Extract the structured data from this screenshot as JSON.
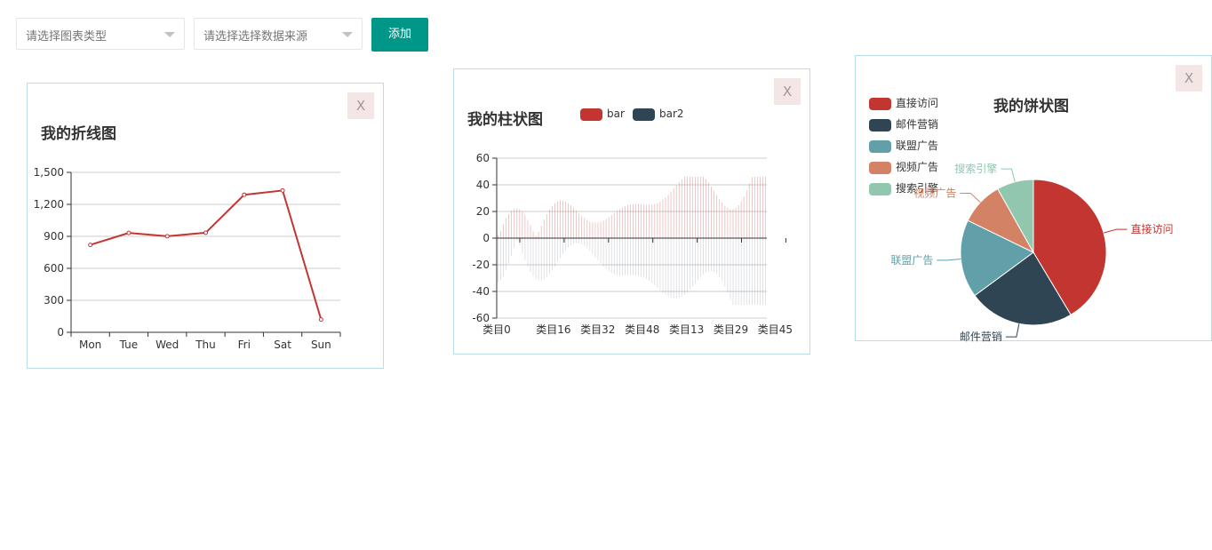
{
  "toolbar": {
    "chart_type_placeholder": "请选择图表类型",
    "data_source_placeholder": "请选择选择数据来源",
    "add_label": "添加"
  },
  "cards": {
    "close_label": "X"
  },
  "colors": {
    "accent": "#009688",
    "red": "#c23531",
    "navy": "#2f4554",
    "teal": "#61a0a8",
    "orange": "#d48265",
    "green": "#91c7ae",
    "card_border": "#b7dfe9",
    "close_bg": "#f5e6e6"
  },
  "chart_data": [
    {
      "type": "line",
      "title": "我的折线图",
      "categories": [
        "Mon",
        "Tue",
        "Wed",
        "Thu",
        "Fri",
        "Sat",
        "Sun"
      ],
      "values": [
        820,
        932,
        901,
        934,
        1290,
        1330,
        120
      ],
      "yticks": [
        "0",
        "300",
        "600",
        "900",
        "1,200",
        "1,500"
      ],
      "ylim": [
        0,
        1500
      ],
      "grid": true
    },
    {
      "type": "bar",
      "title": "我的柱状图",
      "legend": [
        {
          "name": "bar",
          "color": "#c23531"
        },
        {
          "name": "bar2",
          "color": "#2f4554"
        }
      ],
      "xticks": [
        "类目0",
        "类目16",
        "类目32",
        "类目48",
        "类目13",
        "类目29",
        "类目45"
      ],
      "yticks": [
        "-60",
        "-40",
        "-20",
        "0",
        "20",
        "40",
        "60"
      ],
      "ylim": [
        -60,
        60
      ],
      "bar_count": 100,
      "bar_max": 46,
      "bar2_min": -50,
      "grid": true
    },
    {
      "type": "pie",
      "title": "我的饼状图",
      "slices": [
        {
          "name": "直接访问",
          "value": 335,
          "color": "#c23531"
        },
        {
          "name": "邮件营销",
          "value": 190,
          "color": "#2f4554"
        },
        {
          "name": "联盟广告",
          "value": 140,
          "color": "#61a0a8"
        },
        {
          "name": "视频广告",
          "value": 78,
          "color": "#d48265"
        },
        {
          "name": "搜索引擎",
          "value": 66,
          "color": "#91c7ae"
        }
      ],
      "legend_position": "top-left"
    }
  ]
}
